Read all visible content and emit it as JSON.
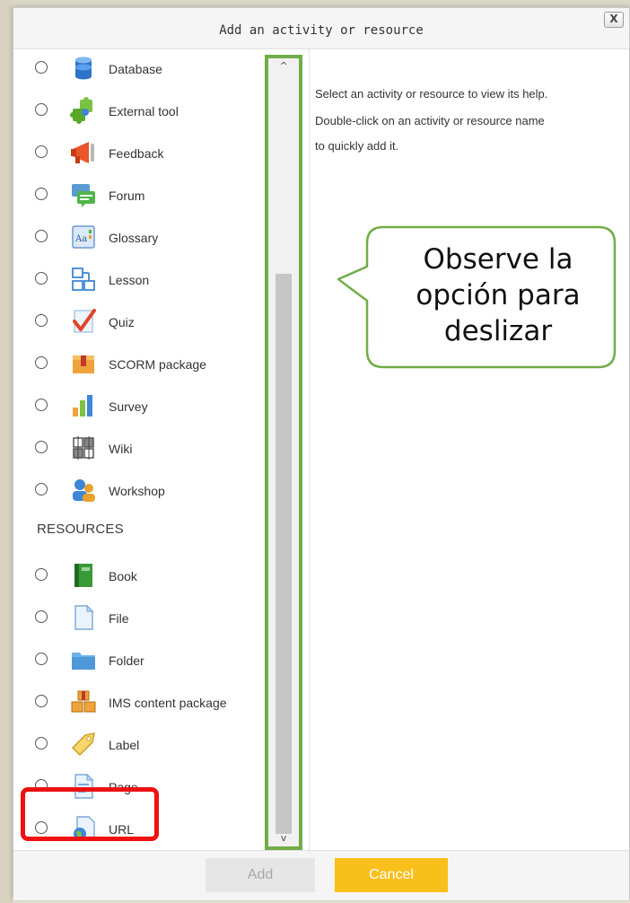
{
  "dialog": {
    "title": "Add an activity or resource",
    "close_label": "X"
  },
  "activities": [
    {
      "label": "Database",
      "icon": "database-icon"
    },
    {
      "label": "External tool",
      "icon": "puzzle-piece-icon"
    },
    {
      "label": "Feedback",
      "icon": "megaphone-icon"
    },
    {
      "label": "Forum",
      "icon": "forum-chat-icon"
    },
    {
      "label": "Glossary",
      "icon": "glossary-book-icon"
    },
    {
      "label": "Lesson",
      "icon": "lesson-flow-icon"
    },
    {
      "label": "Quiz",
      "icon": "checkmark-quiz-icon"
    },
    {
      "label": "SCORM package",
      "icon": "package-box-icon"
    },
    {
      "label": "Survey",
      "icon": "bar-chart-icon"
    },
    {
      "label": "Wiki",
      "icon": "wiki-tiles-icon"
    },
    {
      "label": "Workshop",
      "icon": "people-icon"
    }
  ],
  "resources_heading": "RESOURCES",
  "resources": [
    {
      "label": "Book",
      "icon": "green-book-icon"
    },
    {
      "label": "File",
      "icon": "file-icon"
    },
    {
      "label": "Folder",
      "icon": "folder-icon"
    },
    {
      "label": "IMS content package",
      "icon": "stacked-boxes-icon"
    },
    {
      "label": "Label",
      "icon": "tag-icon"
    },
    {
      "label": "Page",
      "icon": "page-icon"
    },
    {
      "label": "URL",
      "icon": "globe-page-icon"
    }
  ],
  "help": {
    "line1": "Select an activity or resource to view its help.",
    "line2": "Double-click on an activity or resource name",
    "line3": "to quickly add it."
  },
  "callout": {
    "line1": "Observe la",
    "line2": "opción para",
    "line3": "deslizar"
  },
  "scrollbar": {
    "up_arrow": "^",
    "down_arrow": "v"
  },
  "footer": {
    "add_label": "Add",
    "cancel_label": "Cancel"
  },
  "colors": {
    "cancel_button": "#f9bf1b",
    "scrollbar_highlight": "#70ad47",
    "url_highlight": "#ee1111"
  }
}
